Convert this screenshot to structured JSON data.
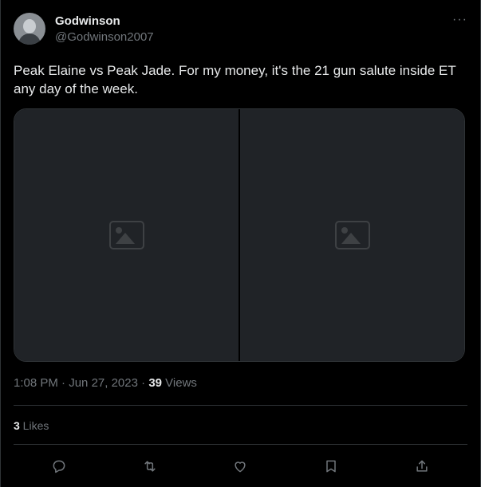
{
  "author": {
    "display_name": "Godwinson",
    "handle": "@Godwinson2007",
    "more_icon": "more-icon"
  },
  "tweet": {
    "text": "Peak Elaine vs Peak Jade. For my money, it's the 21 gun salute inside ET any day of the week."
  },
  "media": {
    "count": 2
  },
  "meta": {
    "time": "1:08 PM",
    "separator_1": " · ",
    "date": "Jun 27, 2023",
    "separator_2": " · ",
    "views_count": "39",
    "views_label": " Views"
  },
  "stats": {
    "likes_count": "3",
    "likes_label": " Likes"
  },
  "actions": {
    "icons": [
      "reply-icon",
      "retweet-icon",
      "like-icon",
      "bookmark-icon",
      "share-icon"
    ]
  },
  "colors": {
    "background": "#000000",
    "text_primary": "#e7e9ea",
    "text_secondary": "#71767b",
    "border": "#2f3336"
  }
}
